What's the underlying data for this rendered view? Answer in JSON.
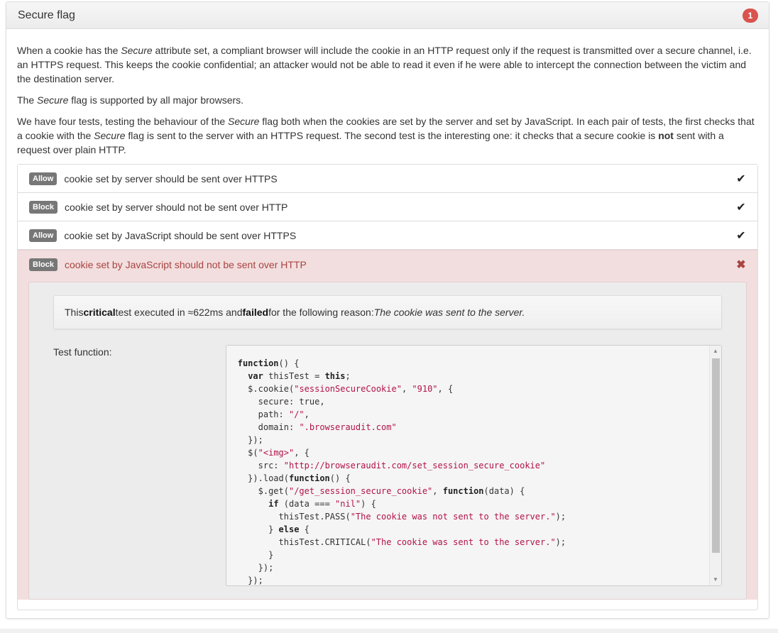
{
  "panel": {
    "title": "Secure flag",
    "badge_count": "1"
  },
  "intro": {
    "p1_a": "When a cookie has the ",
    "p1_em": "Secure",
    "p1_b": " attribute set, a compliant browser will include the cookie in an HTTP request only if the request is transmitted over a secure channel, i.e. an HTTPS request. This keeps the cookie confidential; an attacker would not be able to read it even if he were able to intercept the connection between the victim and the destination server.",
    "p2_a": "The ",
    "p2_em": "Secure",
    "p2_b": " flag is supported by all major browsers.",
    "p3_a": "We have four tests, testing the behaviour of the ",
    "p3_em1": "Secure",
    "p3_b": " flag both when the cookies are set by the server and set by JavaScript. In each pair of tests, the first checks that a cookie with the ",
    "p3_em2": "Secure",
    "p3_c": " flag is sent to the server with an HTTPS request. The second test is the interesting one: it checks that a secure cookie is ",
    "p3_strong": "not",
    "p3_d": " sent with a request over plain HTTP."
  },
  "tests": [
    {
      "label": "Allow",
      "text": "cookie set by server should be sent over HTTPS",
      "result": "pass",
      "mark": "✔"
    },
    {
      "label": "Block",
      "text": "cookie set by server should not be sent over HTTP",
      "result": "pass",
      "mark": "✔"
    },
    {
      "label": "Allow",
      "text": "cookie set by JavaScript should be sent over HTTPS",
      "result": "pass",
      "mark": "✔"
    },
    {
      "label": "Block",
      "text": "cookie set by JavaScript should not be sent over HTTP",
      "result": "fail",
      "mark": "✖"
    }
  ],
  "failure": {
    "prefix": "This ",
    "severity": "critical",
    "middle": " test executed in ≈622ms and ",
    "status": "failed",
    "suffix": " for the following reason: ",
    "reason": "The cookie was sent to the server."
  },
  "test_function": {
    "label": "Test function:",
    "code_lines": [
      [
        [
          "kw",
          "function"
        ],
        [
          "p",
          "() {"
        ]
      ],
      [
        [
          "p",
          "  "
        ],
        [
          "kw",
          "var"
        ],
        [
          "p",
          " thisTest = "
        ],
        [
          "kw",
          "this"
        ],
        [
          "p",
          ";"
        ]
      ],
      [
        [
          "p",
          "  $.cookie("
        ],
        [
          "s",
          "\"sessionSecureCookie\""
        ],
        [
          "p",
          ", "
        ],
        [
          "s",
          "\"910\""
        ],
        [
          "p",
          ", {"
        ]
      ],
      [
        [
          "p",
          "    secure: true,"
        ]
      ],
      [
        [
          "p",
          "    path: "
        ],
        [
          "s",
          "\"/\""
        ],
        [
          "p",
          ","
        ]
      ],
      [
        [
          "p",
          "    domain: "
        ],
        [
          "s",
          "\".browseraudit.com\""
        ]
      ],
      [
        [
          "p",
          "  });"
        ]
      ],
      [
        [
          "p",
          "  $("
        ],
        [
          "s",
          "\"<img>\""
        ],
        [
          "p",
          ", {"
        ]
      ],
      [
        [
          "p",
          "    src: "
        ],
        [
          "s",
          "\"http://browseraudit.com/set_session_secure_cookie\""
        ]
      ],
      [
        [
          "p",
          "  }).load("
        ],
        [
          "kw",
          "function"
        ],
        [
          "p",
          "() {"
        ]
      ],
      [
        [
          "p",
          "    $.get("
        ],
        [
          "s",
          "\"/get_session_secure_cookie\""
        ],
        [
          "p",
          ", "
        ],
        [
          "kw",
          "function"
        ],
        [
          "p",
          "(data) {"
        ]
      ],
      [
        [
          "p",
          "      "
        ],
        [
          "kw",
          "if"
        ],
        [
          "p",
          " (data === "
        ],
        [
          "s",
          "\"nil\""
        ],
        [
          "p",
          ") {"
        ]
      ],
      [
        [
          "p",
          "        thisTest.PASS("
        ],
        [
          "s",
          "\"The cookie was not sent to the server.\""
        ],
        [
          "p",
          ");"
        ]
      ],
      [
        [
          "p",
          "      } "
        ],
        [
          "kw",
          "else"
        ],
        [
          "p",
          " {"
        ]
      ],
      [
        [
          "p",
          "        thisTest.CRITICAL("
        ],
        [
          "s",
          "\"The cookie was sent to the server.\""
        ],
        [
          "p",
          ");"
        ]
      ],
      [
        [
          "p",
          "      }"
        ]
      ],
      [
        [
          "p",
          "    });"
        ]
      ],
      [
        [
          "p",
          "  });"
        ]
      ]
    ]
  },
  "colors": {
    "fail_bg": "#f2dede",
    "fail_text": "#a94442",
    "badge": "#d9534f",
    "label_bg": "#777777"
  }
}
